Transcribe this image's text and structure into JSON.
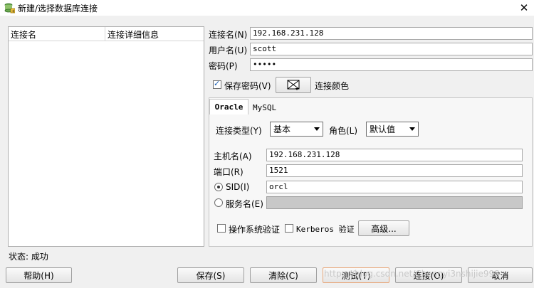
{
  "window": {
    "title": "新建/选择数据库连接",
    "close_glyph": "✕"
  },
  "connection_list": {
    "col_name": "连接名",
    "col_details": "连接详细信息"
  },
  "form": {
    "conn_name_label": "连接名(N)",
    "conn_name_value": "192.168.231.128",
    "username_label": "用户名(U)",
    "username_value": "scott",
    "password_label": "密码(P)",
    "password_value": "•••••",
    "save_password_label": "保存密码(V)",
    "save_password_checked": true,
    "conn_color_label": "连接颜色"
  },
  "tabs": [
    {
      "label": "Oracle",
      "active": true
    },
    {
      "label": "MySQL",
      "active": false
    }
  ],
  "oracle": {
    "conn_type_label": "连接类型(Y)",
    "conn_type_value": "基本",
    "role_label": "角色(L)",
    "role_value": "默认值",
    "host_label": "主机名(A)",
    "host_value": "192.168.231.128",
    "port_label": "端口(R)",
    "port_value": "1521",
    "sid_label": "SID(I)",
    "sid_value": "orcl",
    "service_label": "服务名(E)",
    "service_value": "",
    "os_auth_label": "操作系统验证",
    "kerberos_label": "Kerberos 验证",
    "advanced_label": "高级..."
  },
  "status": {
    "text": "状态: 成功"
  },
  "buttons": {
    "help": "帮助(H)",
    "save": "保存(S)",
    "clear": "清除(C)",
    "test": "测试(T)",
    "connect": "连接(O)",
    "cancel": "取消"
  },
  "watermark": "https://blog.csdn.net/Chengyi3nshijie998"
}
